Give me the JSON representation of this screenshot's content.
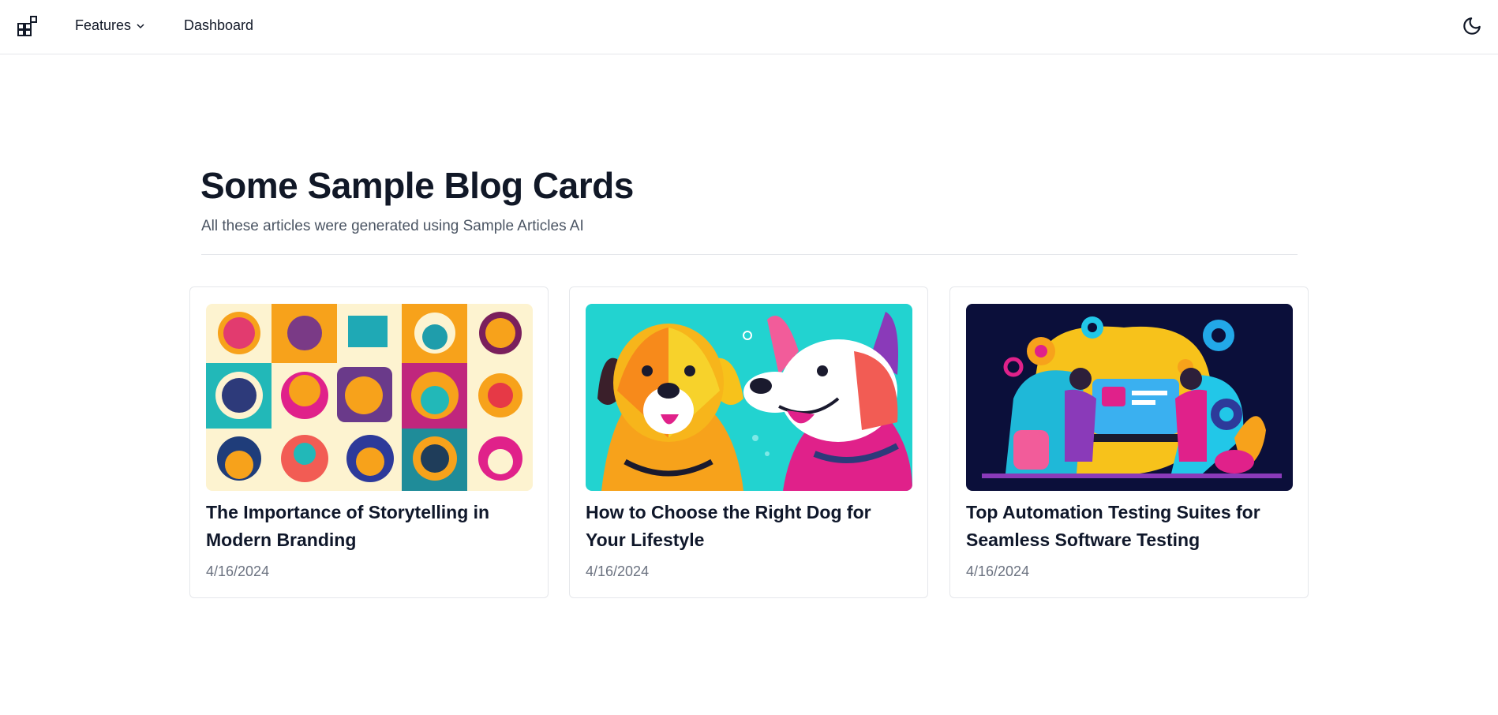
{
  "nav": {
    "logo_icon": "app-grid-icon",
    "features_label": "Features",
    "dashboard_label": "Dashboard",
    "theme_icon": "moon-icon"
  },
  "main": {
    "title": "Some Sample Blog Cards",
    "subtitle": "All these articles were generated using Sample Articles AI"
  },
  "cards": [
    {
      "title": "The Importance of Storytelling in Modern Branding",
      "date": "4/16/2024",
      "image_icon": "storytelling-illustration"
    },
    {
      "title": "How to Choose the Right Dog for Your Lifestyle",
      "date": "4/16/2024",
      "image_icon": "dogs-illustration"
    },
    {
      "title": "Top Automation Testing Suites for Seamless Software Testing",
      "date": "4/16/2024",
      "image_icon": "automation-illustration"
    }
  ],
  "colors": {
    "accent_teal": "#22c7c7",
    "accent_orange": "#f7a21b",
    "accent_pink": "#e0218a",
    "dark_navy": "#0b0f3a",
    "border": "#e5e7eb"
  }
}
